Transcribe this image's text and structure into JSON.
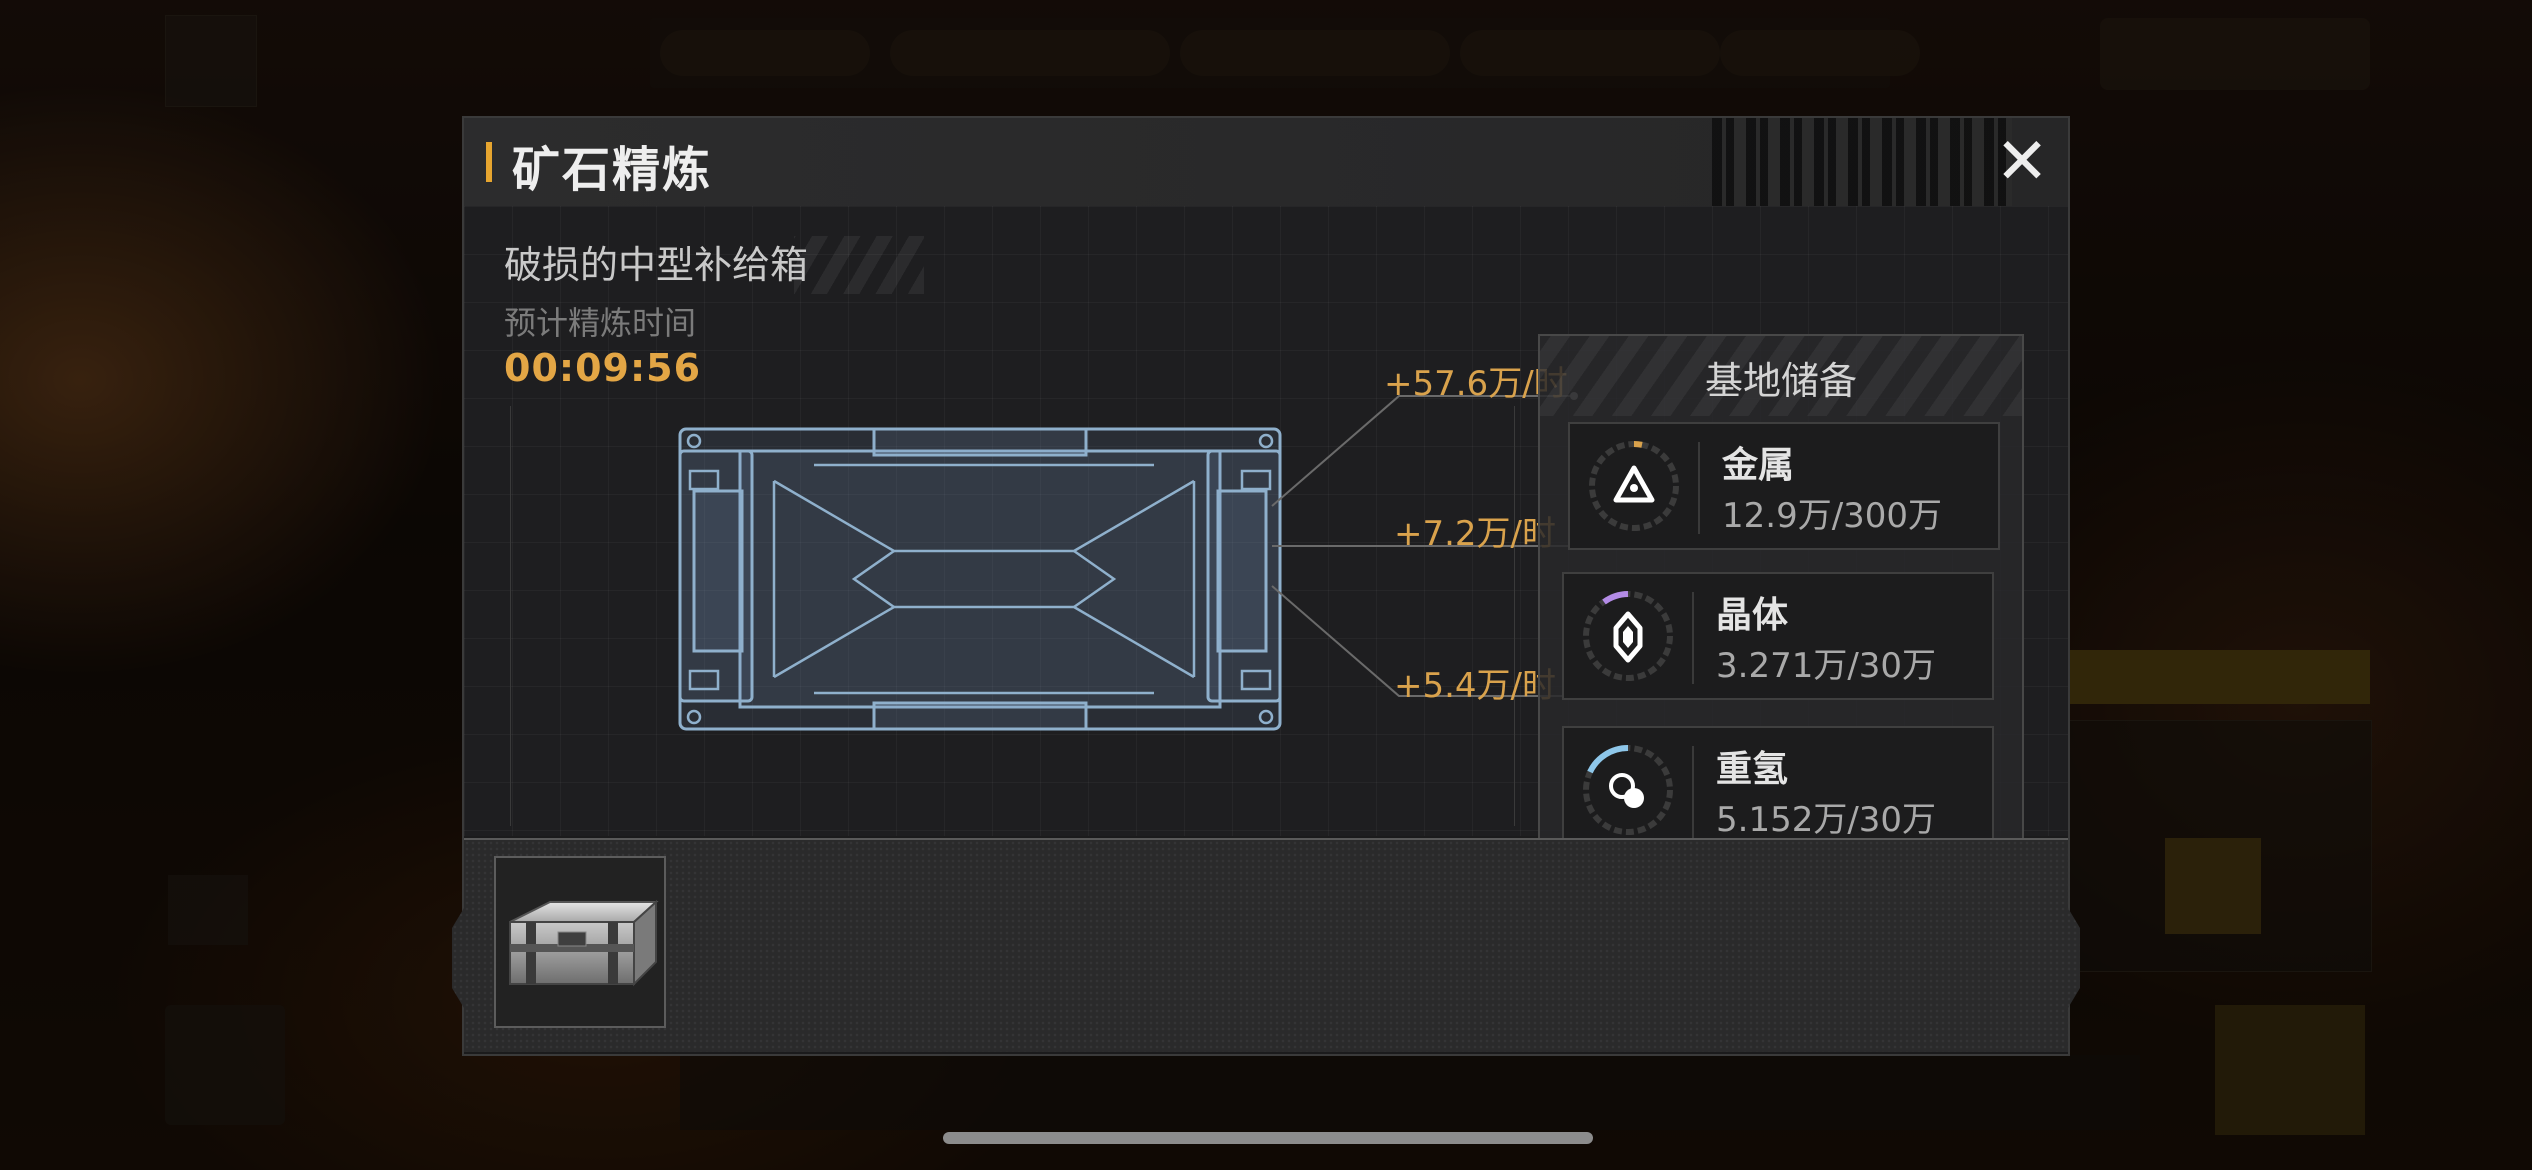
{
  "panel": {
    "title": "矿石精炼",
    "item_name": "破损的中型补给箱",
    "estimate_label": "预计精炼时间",
    "timer": "00:09:56"
  },
  "gains": {
    "metal": "+57.6万/时",
    "crystal": "+7.2万/时",
    "hydrogen": "+5.4万/时"
  },
  "storage": {
    "title": "基地储备",
    "items": [
      {
        "name": "金属",
        "value": "12.9万/300万",
        "icon": "metal-icon",
        "color": "#d9a24c"
      },
      {
        "name": "晶体",
        "value": "3.271万/30万",
        "icon": "crystal-icon",
        "color": "#b38be6"
      },
      {
        "name": "重氢",
        "value": "5.152万/30万",
        "icon": "hydrogen-icon",
        "color": "#8ec7ea"
      }
    ]
  },
  "colors": {
    "accent": "#e6a52f",
    "timer": "#e3a645",
    "gain": "#d9a24c"
  }
}
